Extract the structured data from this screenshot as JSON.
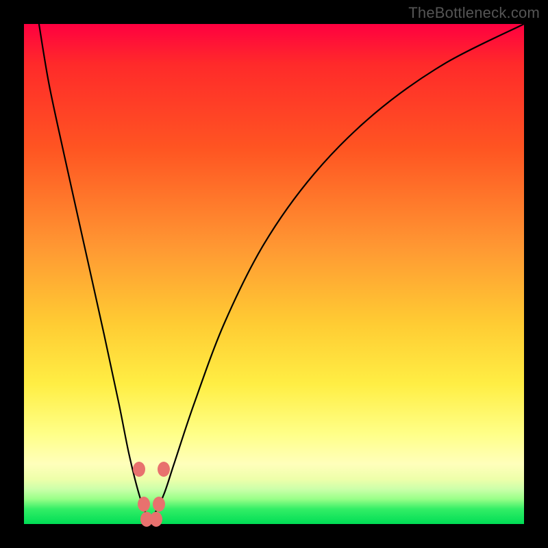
{
  "watermark": "TheBottleneck.com",
  "chart_data": {
    "type": "line",
    "title": "",
    "xlabel": "",
    "ylabel": "",
    "xlim": [
      0,
      100
    ],
    "ylim": [
      0,
      100
    ],
    "grid": false,
    "legend": false,
    "background_gradient": {
      "top": "#ff0040",
      "mid": "#ffee44",
      "bottom": "#00dd55"
    },
    "series": [
      {
        "name": "curve",
        "color": "#000000",
        "x": [
          3,
          5,
          8,
          12,
          16,
          19,
          21,
          23,
          24.5,
          26,
          28,
          30,
          34,
          40,
          48,
          58,
          70,
          84,
          100
        ],
        "y": [
          100,
          88,
          74,
          56,
          38,
          24,
          14,
          6,
          2,
          2,
          6,
          12,
          24,
          40,
          56,
          70,
          82,
          92,
          100
        ]
      }
    ],
    "markers": [
      {
        "x": 23.0,
        "y": 11,
        "color": "#e8716e"
      },
      {
        "x": 28.0,
        "y": 11,
        "color": "#e8716e"
      },
      {
        "x": 24.0,
        "y": 4,
        "color": "#e8716e"
      },
      {
        "x": 27.0,
        "y": 4,
        "color": "#e8716e"
      },
      {
        "x": 24.5,
        "y": 1,
        "color": "#e8716e"
      },
      {
        "x": 26.5,
        "y": 1,
        "color": "#e8716e"
      }
    ]
  }
}
